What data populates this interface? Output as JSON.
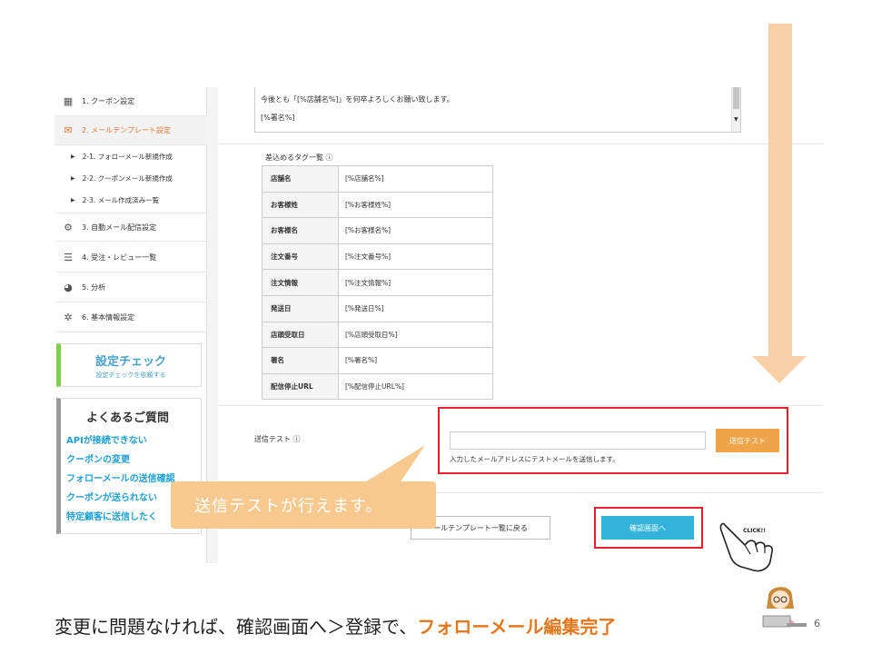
{
  "sidebar": {
    "items": [
      {
        "label": "1. クーポン設定"
      },
      {
        "label": "2. メールテンプレート設定"
      },
      {
        "label": "3. 自動メール配信設定"
      },
      {
        "label": "4. 受注・レビュー一覧"
      },
      {
        "label": "5. 分析"
      },
      {
        "label": "6. 基本情報設定"
      }
    ],
    "sub_items": [
      {
        "label": "2-1. フォローメール新規作成"
      },
      {
        "label": "2-2. クーポンメール新規作成"
      },
      {
        "label": "2-3. メール作成済み一覧"
      }
    ],
    "check": {
      "title": "設定チェック",
      "subtitle": "設定チェックを依頼する"
    },
    "faq": {
      "title": "よくあるご質問",
      "links": [
        "APIが接続できない",
        "クーポンの変更",
        "フォローメールの送信確認",
        "クーポンが送られない",
        "特定顧客に送信したく"
      ]
    }
  },
  "editor": {
    "line1": "今後とも「[%店舗名%]」を何卒よろしくお願い致します。",
    "line2": "[%署名%]"
  },
  "tags": {
    "title": "差込めるタグ一覧 ⓘ",
    "rows": [
      {
        "key": "店舗名",
        "value": "[%店舗名%]"
      },
      {
        "key": "お客様姓",
        "value": "[%お客様姓%]"
      },
      {
        "key": "お客様名",
        "value": "[%お客様名%]"
      },
      {
        "key": "注文番号",
        "value": "[%注文番号%]"
      },
      {
        "key": "注文情報",
        "value": "[%注文情報%]"
      },
      {
        "key": "発送日",
        "value": "[%発送日%]"
      },
      {
        "key": "店頭受取日",
        "value": "[%店頭受取日%]"
      },
      {
        "key": "署名",
        "value": "[%署名%]"
      },
      {
        "key": "配信停止URL",
        "value": "[%配信停止URL%]"
      }
    ]
  },
  "send_test": {
    "label": "送信テスト ⓘ",
    "input_value": "",
    "button": "送信テスト",
    "note": "入力したメールアドレスにテストメールを送信します。"
  },
  "actions": {
    "back": "ールテンプレート一覧に戻る",
    "confirm": "確認画面へ"
  },
  "overlay": {
    "callout": "送信テストが行えます。",
    "click": "CLICK!!"
  },
  "footer": {
    "text": "変更に問題なければ、確認画面へ＞登録で、",
    "highlight": "フォローメール編集完了",
    "page": "6"
  },
  "colors": {
    "accent_orange": "#e3781e",
    "send_button": "#f0a44a",
    "confirm_button": "#33b3d9",
    "highlight_red": "#e5222d",
    "arrow": "#f9cfa6",
    "callout": "#f7c98f"
  }
}
